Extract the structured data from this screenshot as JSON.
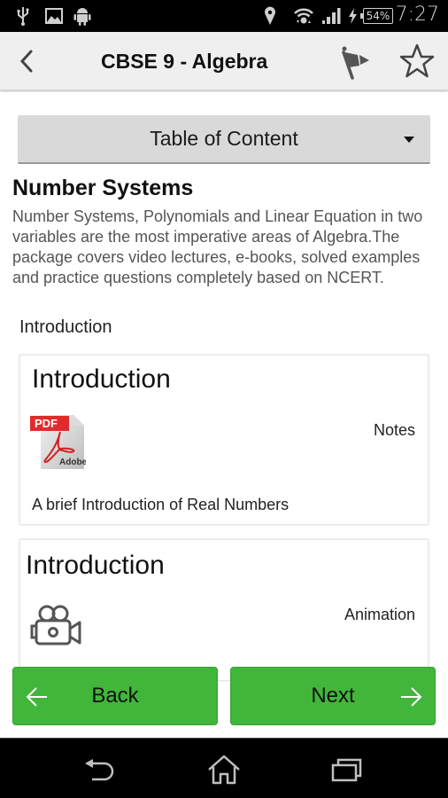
{
  "status_bar": {
    "left_icons": [
      "usb-icon",
      "image-icon",
      "android-icon"
    ],
    "right_icons": [
      "location-icon",
      "wifi-icon",
      "signal-icon",
      "charging-icon"
    ],
    "battery": "54%",
    "time": "7:27"
  },
  "action_bar": {
    "title": "CBSE 9 - Algebra",
    "back_icon": "chevron-left-icon",
    "flag_icon": "flag-icon",
    "star_icon": "star-outline-icon"
  },
  "toc": {
    "label": "Table of Content"
  },
  "section": {
    "title": "Number Systems",
    "description": "Number Systems, Polynomials and Linear Equation in two variables are the most imperative areas of Algebra.The package covers video lectures, e-books, solved examples and practice questions completely based on NCERT.",
    "sub_heading": "Introduction"
  },
  "cards": [
    {
      "title": "Introduction",
      "type": "Notes",
      "icon": "pdf-icon",
      "icon_label_top": "PDF",
      "icon_label_bottom": "Adobe",
      "description": "A brief Introduction of Real Numbers"
    },
    {
      "title": "Introduction",
      "type": "Animation",
      "icon": "video-camera-icon"
    }
  ],
  "buttons": {
    "back": "Back",
    "next": "Next"
  },
  "colors": {
    "button_green": "#41b63b",
    "pdf_red": "#e02020",
    "action_bar_bg": "#efefef"
  },
  "nav_bar": {
    "items": [
      "back-icon",
      "home-icon",
      "recent-apps-icon"
    ]
  }
}
